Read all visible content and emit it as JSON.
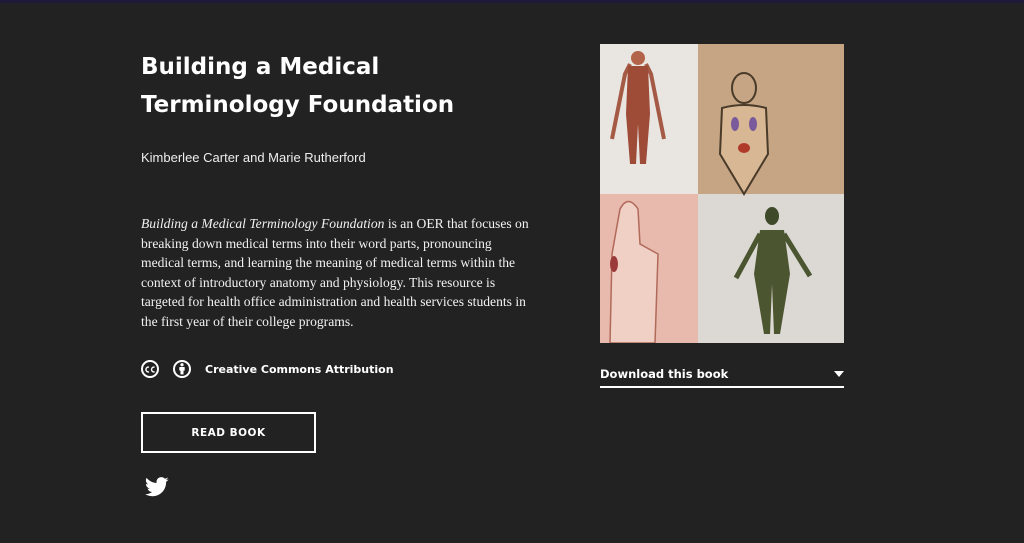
{
  "book": {
    "title": "Building a Medical Terminology Foundation",
    "authors": "Kimberlee Carter and Marie Rutherford",
    "description_title": "Building a Medical Terminology Foundation",
    "description_rest": " is an OER that focuses on breaking down medical terms into their word parts, pronouncing medical terms, and learning the meaning of medical terms within the context of introductory anatomy and physiology. This resource is targeted for health office administration and health services students in the first year of their college programs."
  },
  "license": {
    "label": "Creative Commons Attribution",
    "icons": [
      "cc-icon",
      "attribution-icon"
    ]
  },
  "actions": {
    "read_label": "READ BOOK",
    "download_label": "Download this book",
    "share_icon": "twitter-icon"
  },
  "colors": {
    "background": "#222222",
    "text": "#ffffff",
    "topbar": "#1f1a3a"
  }
}
